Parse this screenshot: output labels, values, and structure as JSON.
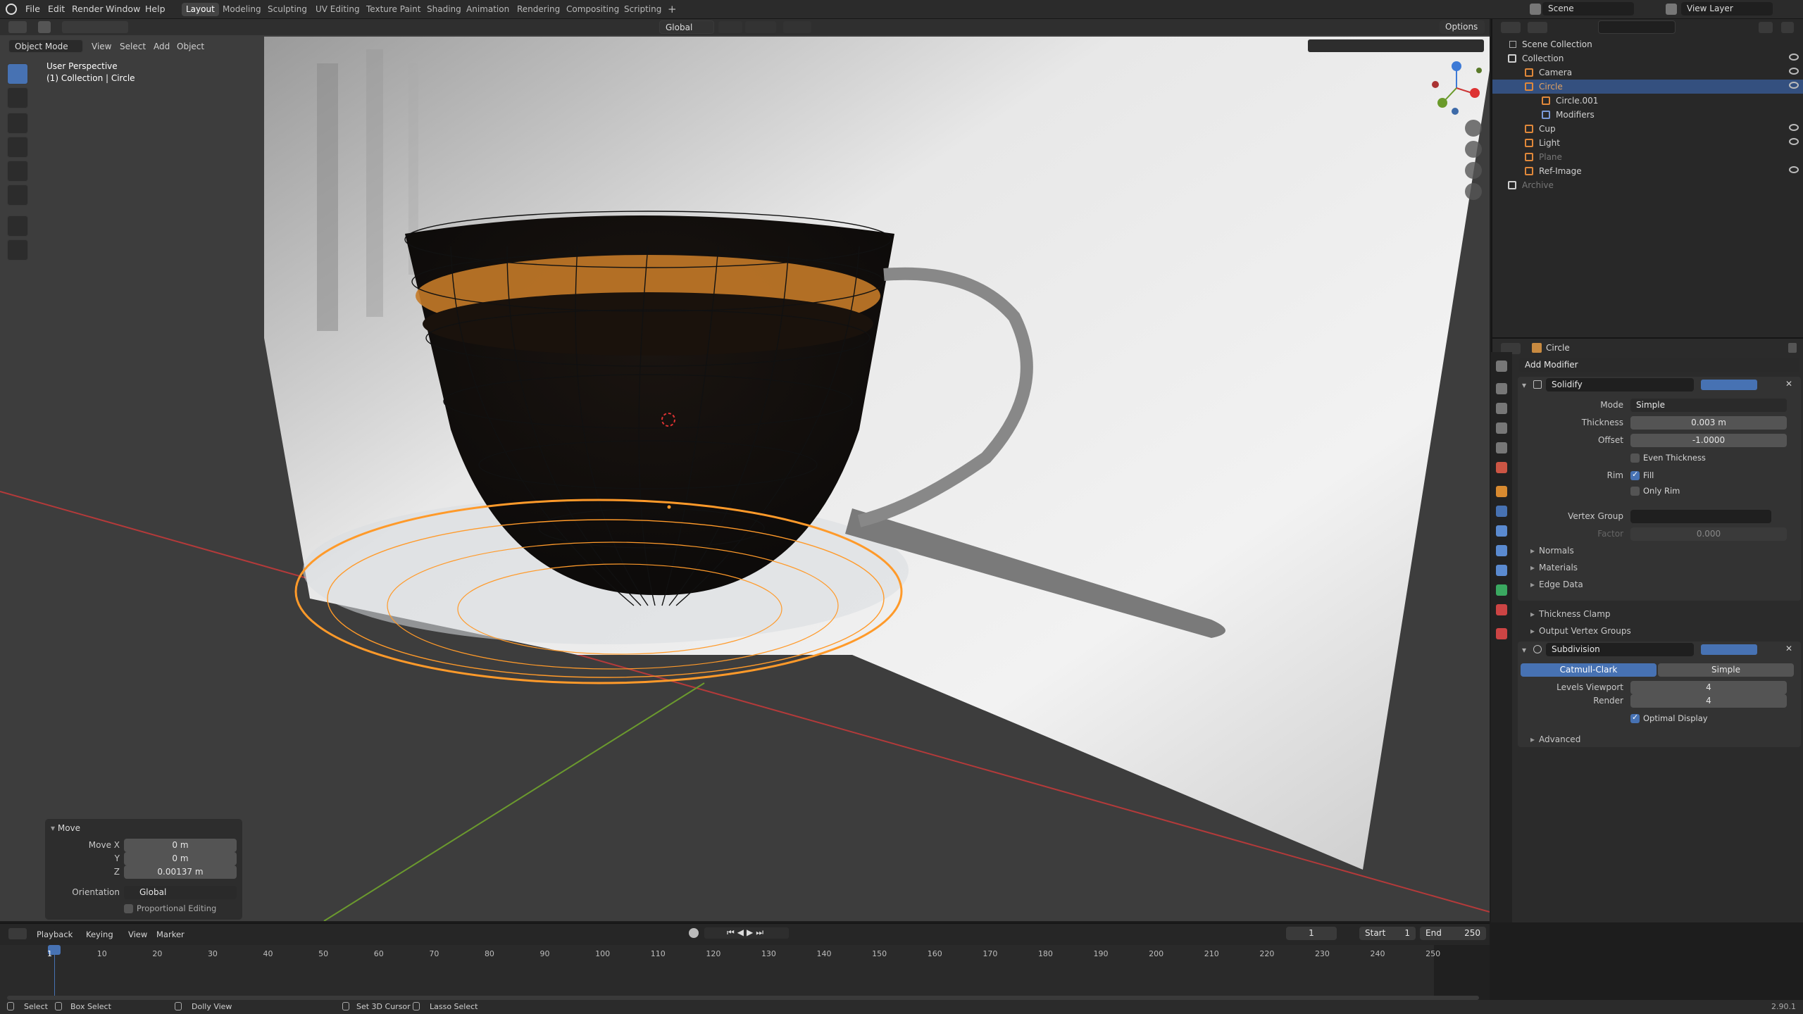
{
  "topbar": {
    "menus": [
      "File",
      "Edit",
      "Render",
      "Window",
      "Help"
    ],
    "workspaces": [
      "Layout",
      "Modeling",
      "Sculpting",
      "UV Editing",
      "Texture Paint",
      "Shading",
      "Animation",
      "Rendering",
      "Compositing",
      "Scripting"
    ],
    "active_workspace": "Layout",
    "scene": "Scene",
    "view_layer": "View Layer"
  },
  "viewport": {
    "mode": "Object Mode",
    "menus": [
      "View",
      "Select",
      "Add",
      "Object"
    ],
    "perspective": "User Perspective",
    "collection_info": "(1) Collection | Circle",
    "transform_orientation": "Global",
    "options": "Options"
  },
  "move_panel": {
    "title": "Move",
    "move_x_label": "Move X",
    "move_x": "0 m",
    "y_label": "Y",
    "y": "0 m",
    "z_label": "Z",
    "z": "0.00137 m",
    "orientation_label": "Orientation",
    "orientation": "Global",
    "proportional": "Proportional Editing"
  },
  "outliner": {
    "scene_collection": "Scene Collection",
    "items": [
      {
        "name": "Collection",
        "color": "#d0d0d0",
        "dim": false
      },
      {
        "name": "Camera",
        "color": "#d0d0d0",
        "dim": false
      },
      {
        "name": "Circle",
        "color": "#e0a060",
        "dim": false
      },
      {
        "name": "Circle.001",
        "color": "#d0d0d0",
        "dim": false
      },
      {
        "name": "Modifiers",
        "color": "#d0d0d0",
        "dim": false
      },
      {
        "name": "Cup",
        "color": "#d0d0d0",
        "dim": false
      },
      {
        "name": "Light",
        "color": "#d0d0d0",
        "dim": false
      },
      {
        "name": "Plane",
        "color": "#777777",
        "dim": true
      },
      {
        "name": "Ref-Image",
        "color": "#d0d0d0",
        "dim": false
      },
      {
        "name": "Archive",
        "color": "#777777",
        "dim": true
      }
    ]
  },
  "properties": {
    "object": "Circle",
    "add_modifier": "Add Modifier",
    "solidify": {
      "name": "Solidify",
      "mode_label": "Mode",
      "mode": "Simple",
      "thickness_label": "Thickness",
      "thickness": "0.003 m",
      "offset_label": "Offset",
      "offset": "-1.0000",
      "even_thickness": "Even Thickness",
      "rim_label": "Rim",
      "fill": "Fill",
      "only_rim": "Only Rim",
      "vertex_group_label": "Vertex Group",
      "factor_label": "Factor",
      "factor": "0.000",
      "subpanels": [
        "Normals",
        "Materials",
        "Edge Data",
        "Thickness Clamp",
        "Output Vertex Groups"
      ]
    },
    "subdivision": {
      "name": "Subdivision",
      "catmull": "Catmull-Clark",
      "simple": "Simple",
      "levels_viewport_label": "Levels Viewport",
      "levels_viewport": "4",
      "render_label": "Render",
      "render": "4",
      "optimal": "Optimal Display",
      "advanced": "Advanced"
    }
  },
  "timeline": {
    "menus": [
      "Playback",
      "Keying",
      "View",
      "Marker"
    ],
    "current_frame": "1",
    "start_label": "Start",
    "start": "1",
    "end_label": "End",
    "end": "250",
    "ticks": [
      "1",
      "10",
      "20",
      "30",
      "40",
      "50",
      "60",
      "70",
      "80",
      "90",
      "100",
      "110",
      "120",
      "130",
      "140",
      "150",
      "160",
      "170",
      "180",
      "190",
      "200",
      "210",
      "220",
      "230",
      "240",
      "250"
    ]
  },
  "statusbar": {
    "items": [
      "Select",
      "Box Select",
      "Dolly View",
      "Set 3D Cursor",
      "Lasso Select"
    ],
    "version": "2.90.1"
  },
  "colors": {
    "accent": "#4772b3",
    "selection": "#ff9a2a",
    "x_axis": "#c23a3a",
    "y_axis": "#6e9a2e"
  }
}
